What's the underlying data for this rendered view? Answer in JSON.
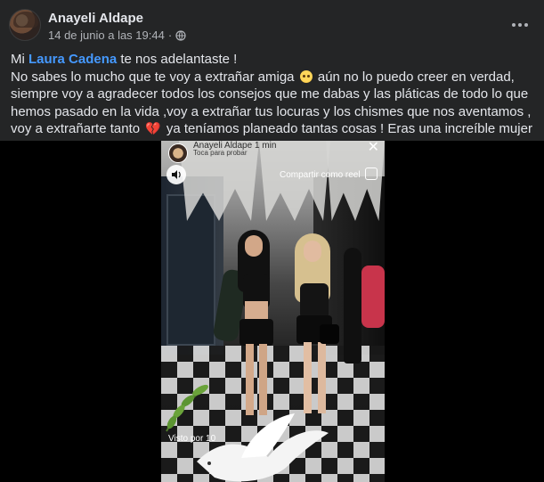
{
  "post": {
    "author": "Anayeli Aldape",
    "timestamp": "14 de junio a las 19:44",
    "separator": "·",
    "privacy_icon": "globe-icon",
    "more_icon": "more-options-icon"
  },
  "message": {
    "line1_prefix": "Mi",
    "mention": "Laura Cadena",
    "line1_suffix": "te nos adelantaste !",
    "body_part1": "No sabes lo mucho que te voy a extrañar amiga",
    "body_part2": "aún no lo puedo creer en verdad, siempre voy a agradecer todos los consejos que me dabas y las pláticas de todo lo que hemos pasado en la vida ,voy a extrañar tus locuras y los chismes que nos aventamos , voy a extrañarte tanto",
    "body_part3": "ya teníamos planeado tantas cosas ! Eras una increíble mujer !",
    "emoji1": "sad-face-emoji",
    "emoji2": "broken-heart-emoji",
    "heart_glyph": "💔"
  },
  "story": {
    "author": "Anayeli Aldape",
    "age": "1 min",
    "sub": "Toca para probar",
    "share_label": "Compartir como reel",
    "views_label": "Visto por 10",
    "close_glyph": "✕",
    "colors": {
      "accent": "#4599ff",
      "background": "#242526",
      "text": "#e4e6eb",
      "muted": "#b0b3b8"
    }
  }
}
